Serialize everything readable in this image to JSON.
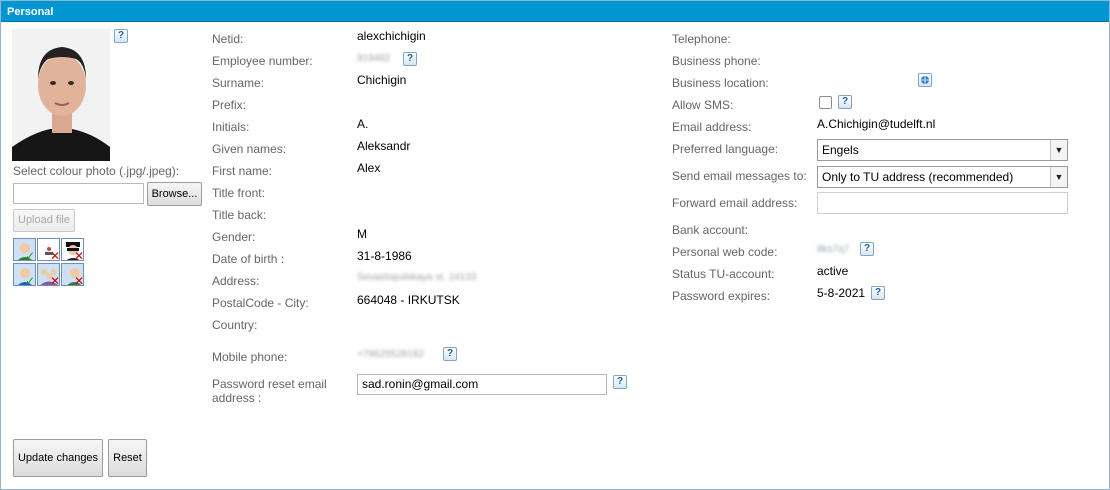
{
  "panel": {
    "title": "Personal"
  },
  "photo": {
    "select_label": "Select colour photo (.jpg/.jpeg):",
    "browse_label": "Browse...",
    "upload_label": "Upload file",
    "help": "?"
  },
  "avatar_options": [
    {
      "icon": "person-approved-icon",
      "status": "ok"
    },
    {
      "icon": "person-placeholder-icon",
      "status": "rejected"
    },
    {
      "icon": "masked-person-icon",
      "status": "rejected"
    },
    {
      "icon": "person-approved-icon",
      "status": "ok"
    },
    {
      "icon": "group-photo-icon",
      "status": "rejected"
    },
    {
      "icon": "person-side-icon",
      "status": "rejected"
    }
  ],
  "fields_mid": {
    "netid": {
      "label": "Netid:",
      "value": "alexchichigin"
    },
    "employee_number": {
      "label": "Employee number:",
      "value": "919482"
    },
    "surname": {
      "label": "Surname:",
      "value": "Chichigin"
    },
    "prefix": {
      "label": "Prefix:",
      "value": ""
    },
    "initials": {
      "label": "Initials:",
      "value": "A."
    },
    "given_names": {
      "label": "Given names:",
      "value": "Aleksandr"
    },
    "first_name": {
      "label": "First name:",
      "value": "Alex"
    },
    "title_front": {
      "label": "Title front:",
      "value": ""
    },
    "title_back": {
      "label": "Title back:",
      "value": ""
    },
    "gender": {
      "label": "Gender:",
      "value": "M"
    },
    "dob": {
      "label": "Date of birth :",
      "value": "31-8-1986"
    },
    "address": {
      "label": "Address:",
      "value": "Sevastopolskaya st. 24133"
    },
    "postal_city": {
      "label": "PostalCode - City:",
      "value": "664048 - IRKUTSK"
    },
    "country": {
      "label": "Country:",
      "value": ""
    },
    "mobile": {
      "label": "Mobile phone:",
      "value": "+79625528182"
    },
    "pw_reset_email": {
      "label_line1": "Password reset email",
      "label_line2": "address :",
      "value": "sad.ronin@gmail.com"
    }
  },
  "fields_right": {
    "telephone": {
      "label": "Telephone:",
      "value": ""
    },
    "business_phone": {
      "label": "Business phone:",
      "value": ""
    },
    "business_location": {
      "label": "Business location:",
      "value": ""
    },
    "allow_sms": {
      "label": "Allow SMS:",
      "checked": false
    },
    "email": {
      "label": "Email address:",
      "value": "A.Chichigin@tudelft.nl"
    },
    "preferred_language": {
      "label": "Preferred language:",
      "value": "Engels"
    },
    "send_email": {
      "label": "Send email messages to:",
      "value": "Only to TU address (recommended)"
    },
    "forward_email": {
      "label": "Forward email address:",
      "value": ""
    },
    "bank_account": {
      "label": "Bank account:",
      "value": ""
    },
    "web_code": {
      "label": "Personal web code:",
      "value": "8ks7q7"
    },
    "status": {
      "label": "Status TU-account:",
      "value": "active"
    },
    "pw_expires": {
      "label": "Password expires:",
      "value": "5-8-2021"
    }
  },
  "help_glyph": "?",
  "arrow_glyph": "▼",
  "actions": {
    "update": "Update changes",
    "reset": "Reset"
  }
}
